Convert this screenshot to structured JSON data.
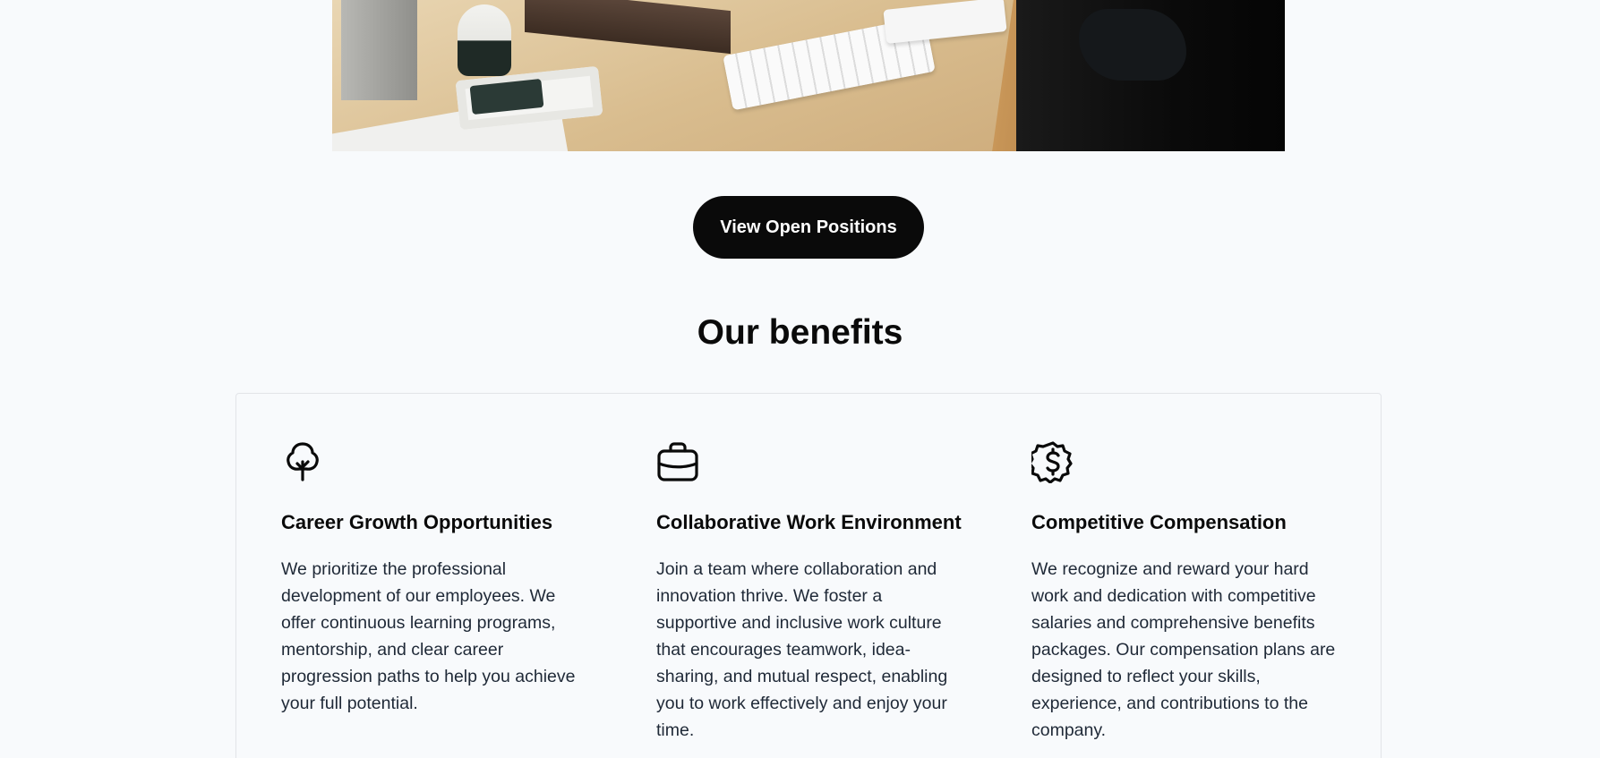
{
  "hero": {
    "image_alt": "Office desk with keyboard and trackpad"
  },
  "cta": {
    "label": "View Open Positions"
  },
  "benefits": {
    "title": "Our benefits",
    "items": [
      {
        "icon": "tree-icon",
        "title": "Career Growth Opportunities",
        "description": "We prioritize the professional development of our employees. We offer continuous learning programs, mentorship, and clear career progression paths to help you achieve your full potential."
      },
      {
        "icon": "briefcase-icon",
        "title": "Collaborative Work Environment",
        "description": "Join a team where collaboration and innovation thrive. We foster a supportive and inclusive work culture that encourages teamwork, idea-sharing, and mutual respect, enabling you to work effectively and enjoy your time."
      },
      {
        "icon": "dollar-badge-icon",
        "title": "Competitive Compensation",
        "description": "We recognize and reward your hard work and dedication with competitive salaries and comprehensive benefits packages. Our compensation plans are designed to reflect your skills, experience, and contributions to the company."
      }
    ]
  }
}
